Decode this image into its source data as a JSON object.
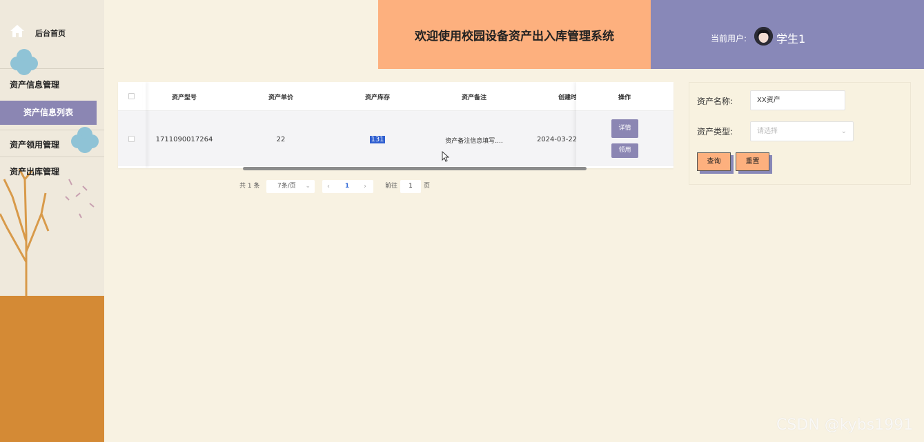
{
  "sidebar": {
    "home_label": "后台首页",
    "menu": [
      {
        "label": "资产信息管理"
      },
      {
        "label": "资产信息列表"
      },
      {
        "label": "资产领用管理"
      },
      {
        "label": "资产出库管理"
      }
    ]
  },
  "header": {
    "title": "欢迎使用校园设备资产出入库管理系统",
    "user_label": "当前用户:",
    "user_name": "学生1"
  },
  "table": {
    "columns": [
      "资产型号",
      "资产单价",
      "资产库存",
      "资产备注",
      "创建时间",
      "操作"
    ],
    "rows": [
      {
        "model": "1711090017264",
        "price": "22",
        "stock": "131",
        "remark": "资产备注信息填写....",
        "created": "2024-03-22",
        "actions": [
          "详情",
          "领用"
        ]
      }
    ]
  },
  "pagination": {
    "total": "共 1 条",
    "page_size": "7条/页",
    "current_page": "1",
    "goto_label": "前往",
    "goto_value": "1",
    "goto_unit": "页"
  },
  "search": {
    "name_label": "资产名称:",
    "name_value": "XX资产",
    "type_label": "资产类型:",
    "type_placeholder": "请选择",
    "query_label": "查询",
    "reset_label": "重置"
  },
  "watermark": "CSDN @kybs1991",
  "colors": {
    "accent_purple": "#8b86b3",
    "accent_orange": "#fdb07e",
    "sidebar_ground": "#d48a35",
    "background": "#f8f2e2"
  }
}
